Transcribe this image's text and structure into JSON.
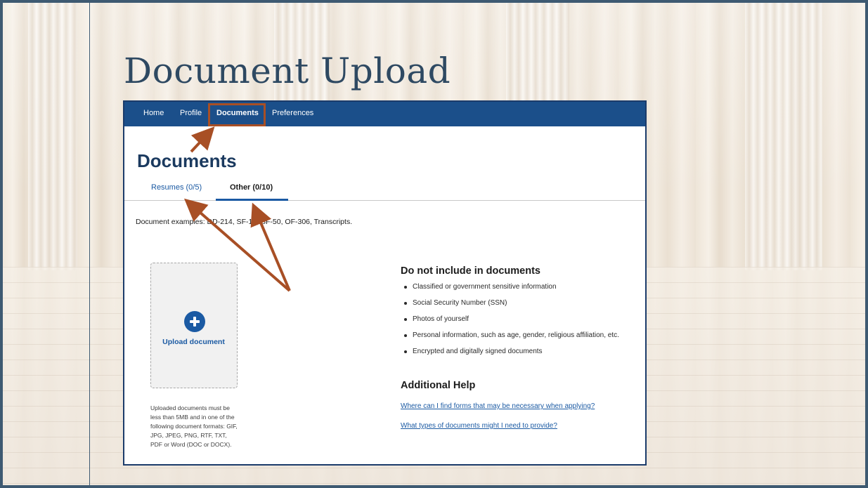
{
  "slide": {
    "title": "Document Upload"
  },
  "nav": {
    "items": [
      {
        "label": "Home",
        "active": false
      },
      {
        "label": "Profile",
        "active": false
      },
      {
        "label": "Documents",
        "active": true
      },
      {
        "label": "Preferences",
        "active": false
      }
    ]
  },
  "page": {
    "heading": "Documents",
    "tabs": [
      {
        "label": "Resumes (0/5)",
        "active": false
      },
      {
        "label": "Other (0/10)",
        "active": true
      }
    ],
    "examples": "Document examples: DD-214, SF-15, SF-50, OF-306, Transcripts.",
    "upload": {
      "label": "Upload document",
      "icon": "plus-circle-icon",
      "note": "Uploaded documents must be less than 5MB and in one of the following document formats: GIF, JPG, JPEG, PNG, RTF, TXT, PDF or Word (DOC or DOCX)."
    },
    "do_not_include": {
      "heading": "Do not include in documents",
      "items": [
        "Classified or government sensitive information",
        "Social Security Number (SSN)",
        "Photos of yourself",
        "Personal information, such as age, gender, religious affiliation, etc.",
        "Encrypted and digitally signed documents"
      ]
    },
    "additional_help": {
      "heading": "Additional Help",
      "links": [
        "Where can I find forms that may be necessary when applying?",
        "What types of documents might I need to provide?"
      ]
    }
  },
  "colors": {
    "nav_bg": "#1b4f8a",
    "link": "#1b5aa3",
    "annotation": "#a84f25",
    "slide_title": "#2e4962"
  }
}
